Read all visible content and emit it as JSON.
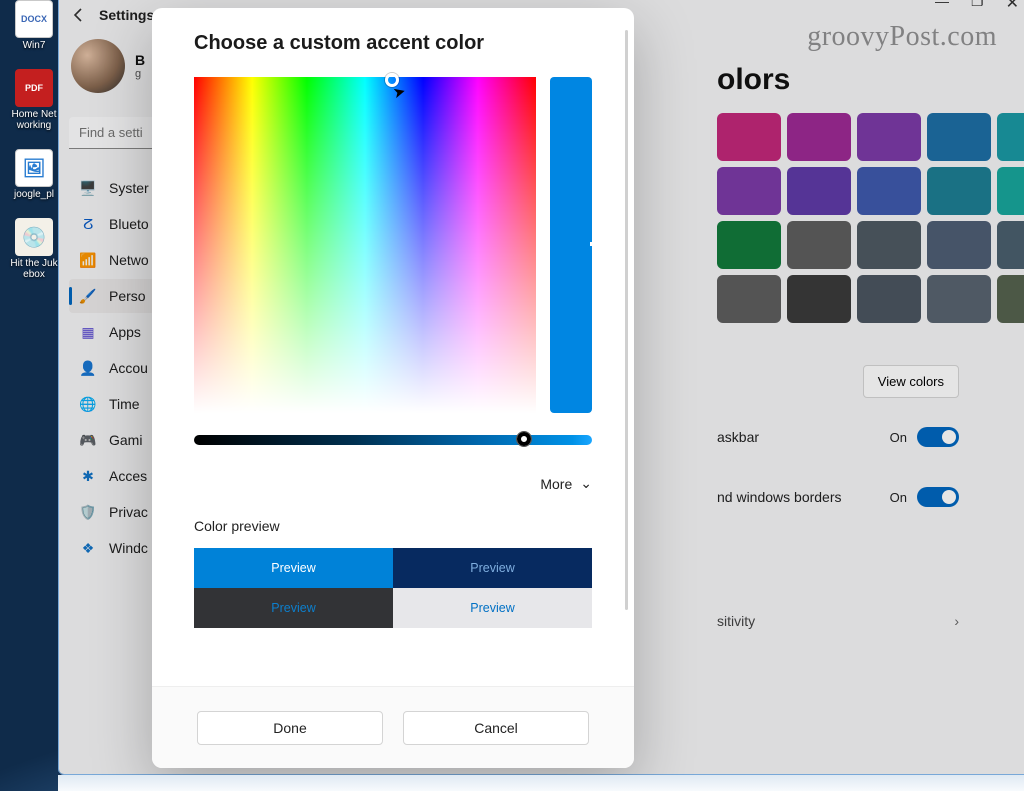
{
  "desktop": {
    "icons": [
      {
        "label": "Win7",
        "glyph": "DOCX",
        "bg": "#ffffff",
        "fg": "#3a66b5"
      },
      {
        "label": "Home Networking",
        "glyph": "PDF",
        "bg": "#c41f1f",
        "fg": "#ffffff"
      },
      {
        "label": "joogle_pl",
        "glyph": "🖼",
        "bg": "#ffffff",
        "fg": "#2a7dd1"
      },
      {
        "label": "Hit the Jukebox",
        "glyph": "💿",
        "bg": "#f3f0e8",
        "fg": "#222"
      }
    ]
  },
  "window": {
    "chrome": {
      "min": "—",
      "max": "❐",
      "close": "✕"
    },
    "watermark": "groovyPost.com"
  },
  "settings": {
    "app_title": "Settings",
    "user": {
      "name": "B",
      "sub": "g"
    },
    "search_placeholder": "Find a setti",
    "nav": [
      {
        "label": "Syster",
        "ico": "🖥️",
        "color": "#2b6cb0"
      },
      {
        "label": "Blueto",
        "ico": "ⵒ",
        "color": "#0a5cc7"
      },
      {
        "label": "Netwo",
        "ico": "📶",
        "color": "#12897d"
      },
      {
        "label": "Perso",
        "ico": "🖌️",
        "color": "#b66b1f",
        "active": true
      },
      {
        "label": "Apps",
        "ico": "▦",
        "color": "#5a4ad1"
      },
      {
        "label": "Accou",
        "ico": "👤",
        "color": "#2e936b"
      },
      {
        "label": "Time",
        "ico": "🌐",
        "color": "#2f7fbe"
      },
      {
        "label": "Gami",
        "ico": "🎮",
        "color": "#6c6c6c"
      },
      {
        "label": "Acces",
        "ico": "✱",
        "color": "#1173c7"
      },
      {
        "label": "Privac",
        "ico": "🛡️",
        "color": "#7a7a7a"
      },
      {
        "label": "Windc",
        "ico": "❖",
        "color": "#1173c7"
      }
    ]
  },
  "page": {
    "title": "olors",
    "swatches": [
      "#c2277a",
      "#9e2a95",
      "#7c3aa7",
      "#1d6fa5",
      "#1a99a4",
      "#7c3aa7",
      "#5f3aa7",
      "#3f5aad",
      "#1e7e94",
      "#18a69c",
      "#127a3b",
      "#5e5e5e",
      "#4f5a63",
      "#4f5e74",
      "#4a5f6e",
      "#5e5e5e",
      "#3a3a3a",
      "#4b5560",
      "#596470",
      "#55624f"
    ],
    "view_colors": "View colors",
    "row1": {
      "label": "askbar",
      "state": "On"
    },
    "row2": {
      "label": "nd windows borders",
      "state": "On"
    },
    "row3": {
      "label": "sitivity"
    }
  },
  "dialog": {
    "title": "Choose a custom accent color",
    "more": "More",
    "section": "Color preview",
    "preview_label": "Preview",
    "done": "Done",
    "cancel": "Cancel"
  }
}
